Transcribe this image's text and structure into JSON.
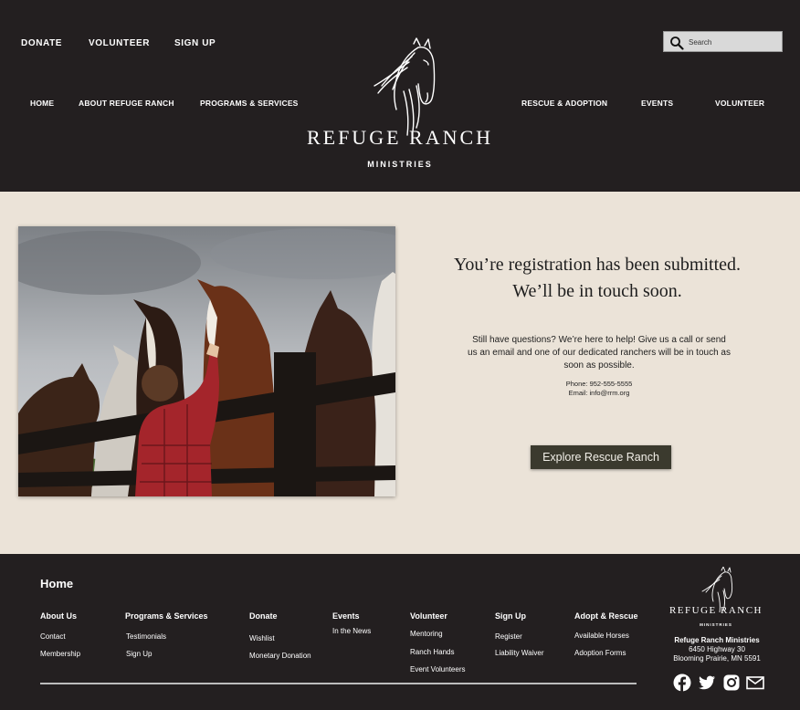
{
  "header": {
    "top_links": {
      "donate": "DONATE",
      "volunteer": "VOLUNTEER",
      "sign_up": "SIGN UP"
    },
    "search": {
      "placeholder": "Search"
    },
    "nav": {
      "home": "HOME",
      "about": "ABOUT REFUGE RANCH",
      "programs": "PROGRAMS & SERVICES",
      "rescue": "RESCUE & ADOPTION",
      "events": "EVENTS",
      "volunteer": "VOLUNTEER"
    },
    "logo": {
      "name": "REFUGE RANCH",
      "sub": "MINISTRIES"
    }
  },
  "main": {
    "title_line1": "You’re registration has been submitted.",
    "title_line2": "We’ll be in touch soon.",
    "help_text": "Still have questions? We’re here to help! Give us a call or send us an email and one of our dedicated ranchers will be in touch as soon as possible.",
    "phone": "Phone: 952-555-5555",
    "email": "Email: info@rrm.org",
    "button": "Explore Rescue Ranch"
  },
  "footer": {
    "home": "Home",
    "columns": {
      "about": {
        "heading": "About Us",
        "links": [
          "Contact",
          "Membership"
        ]
      },
      "programs": {
        "heading": "Programs & Services",
        "links": [
          "Testimonials",
          "Sign Up"
        ]
      },
      "donate": {
        "heading": "Donate",
        "links": [
          "Wishlist",
          "Monetary Donation"
        ]
      },
      "events": {
        "heading": "Events",
        "links": [
          "In the News"
        ]
      },
      "volunteer": {
        "heading": "Volunteer",
        "links": [
          "Mentoring",
          "Ranch Hands",
          "Event Volunteers"
        ]
      },
      "signup": {
        "heading": "Sign Up",
        "links": [
          "Register",
          "Liability Waiver"
        ]
      },
      "adopt": {
        "heading": "Adopt & Rescue",
        "links": [
          "Available Horses",
          "Adoption Forms"
        ]
      }
    },
    "logo": {
      "name": "REFUGE RANCH",
      "sub": "MINISTRIES"
    },
    "org_name": "Refuge Ranch Ministries",
    "address1": "6450 Highway 30",
    "address2": "Blooming Prairie, MN 5591",
    "social_icons": [
      "facebook-icon",
      "twitter-icon",
      "instagram-icon",
      "mail-icon"
    ]
  },
  "colors": {
    "dark_background": "#231f20",
    "content_background": "#ebe3d8",
    "button_background": "#3b3a2e"
  }
}
